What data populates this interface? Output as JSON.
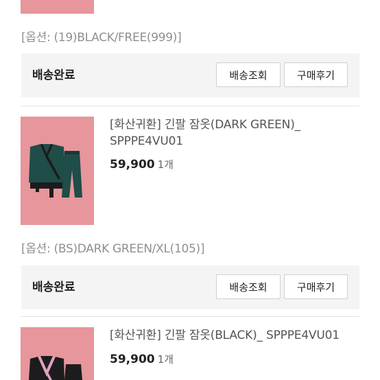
{
  "orders": [
    {
      "option": "[옵션: (19)BLACK/FREE(999)]",
      "status": "배송완료",
      "track_label": "배송조회",
      "review_label": "구매후기"
    },
    {
      "product_name": "[화산귀환] 긴팔 잠옷(DARK GREEN)_ SPPPE4VU01",
      "price": "59,900",
      "qty": "1개",
      "option": "[옵션: (BS)DARK GREEN/XL(105)]",
      "status": "배송완료",
      "track_label": "배송조회",
      "review_label": "구매후기"
    },
    {
      "product_name": "[화산귀환] 긴팔 잠옷(BLACK)_ SPPPE4VU01",
      "price": "59,900",
      "qty": "1개"
    }
  ],
  "colors": {
    "thumbnail_bg": "#e7969b",
    "pajama_green": "#1f4d48",
    "pajama_black": "#1c1c1e",
    "trim_pink": "#e0a0c0"
  }
}
